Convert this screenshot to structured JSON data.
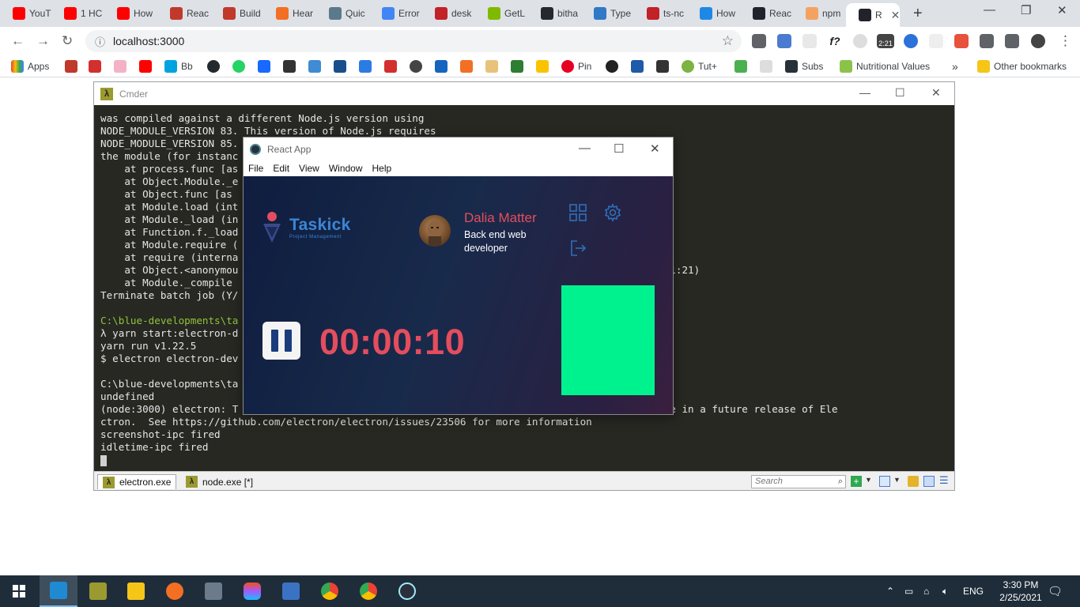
{
  "browser": {
    "tabs": [
      {
        "label": "YouT",
        "icon": "youtube-icon",
        "color": "#ff0000"
      },
      {
        "label": "1 HC",
        "icon": "youtube-icon",
        "color": "#ff0000"
      },
      {
        "label": "How",
        "icon": "youtube-icon",
        "color": "#ff0000"
      },
      {
        "label": "Reac",
        "icon": "react-icon",
        "color": "#c0392b"
      },
      {
        "label": "Build",
        "icon": "react-icon",
        "color": "#c0392b"
      },
      {
        "label": "Hear",
        "icon": "soundcloud-icon",
        "color": "#f26f23"
      },
      {
        "label": "Quic",
        "icon": "gear-icon",
        "color": "#5a7a8c"
      },
      {
        "label": "Error",
        "icon": "google-icon",
        "color": "#4285f4"
      },
      {
        "label": "desk",
        "icon": "npm-icon",
        "color": "#c12127"
      },
      {
        "label": "GetL",
        "icon": "microsoft-icon",
        "color": "#7fba00"
      },
      {
        "label": "bitha",
        "icon": "github-icon",
        "color": "#24292e"
      },
      {
        "label": "Type",
        "icon": "typescript-icon",
        "color": "#3178c6"
      },
      {
        "label": "ts-nc",
        "icon": "npm-icon",
        "color": "#c12127"
      },
      {
        "label": "How",
        "icon": "blue-circle-icon",
        "color": "#1e88e5"
      },
      {
        "label": "Reac",
        "icon": "react-icon",
        "color": "#20232a"
      },
      {
        "label": "npm",
        "icon": "npm-icon",
        "color": "#f4a261"
      },
      {
        "label": "R",
        "icon": "react-icon",
        "color": "#20232a"
      }
    ],
    "url": "localhost:3000",
    "bookmarks": {
      "apps_label": "Apps",
      "bb_label": "Bb",
      "pin_label": "Pin",
      "tut_label": "Tut+",
      "subs_label": "Subs",
      "nutrition_label": "Nutritional Values",
      "more_label": "»",
      "other_label": "Other bookmarks"
    },
    "ext_time": "2:21"
  },
  "cmder": {
    "title": "Cmder",
    "lines": [
      {
        "text": "was compiled against a different Node.js version using",
        "style": ""
      },
      {
        "text": "NODE_MODULE_VERSION 83. This version of Node.js requires",
        "style": ""
      },
      {
        "text": "NODE_MODULE_VERSION 85.",
        "style": ""
      },
      {
        "text": "the module (for instanc",
        "style": ""
      },
      {
        "text": "    at process.func [as",
        "style": ""
      },
      {
        "text": "    at Object.Module._e",
        "style": ""
      },
      {
        "text": "    at Object.func [as",
        "style": ""
      },
      {
        "text": "    at Module.load (int",
        "style": ""
      },
      {
        "text": "    at Module._load (in",
        "style": ""
      },
      {
        "text": "    at Function.f._load",
        "style": ""
      },
      {
        "text": "    at Module.require (",
        "style": ""
      },
      {
        "text": "    at require (interna",
        "style": ""
      },
      {
        "text": "    at Object.<anonymou                                                       op-idle\\index.js:1:21)",
        "style": ""
      },
      {
        "text": "    at Module._compile",
        "style": ""
      },
      {
        "text": "Terminate batch job (Y/",
        "style": ""
      },
      {
        "text": "",
        "style": ""
      },
      {
        "text": "C:\\blue-developments\\ta",
        "style": "g"
      },
      {
        "text": "λ yarn start:electron-d",
        "style": ""
      },
      {
        "text": "yarn run v1.22.5",
        "style": ""
      },
      {
        "text": "$ electron electron-dev",
        "style": ""
      },
      {
        "text": "",
        "style": ""
      },
      {
        "text": "C:\\blue-developments\\ta",
        "style": ""
      },
      {
        "text": "undefined",
        "style": ""
      },
      {
        "text": "(node:3000) electron: T                                                         om false to true in a future release of Ele",
        "style": ""
      },
      {
        "text": "ctron.  See https://github.com/electron/electron/issues/23506 for more information",
        "style": ""
      },
      {
        "text": "screenshot-ipc fired",
        "style": ""
      },
      {
        "text": "idletime-ipc fired",
        "style": ""
      }
    ],
    "tabs": [
      {
        "label": "electron.exe"
      },
      {
        "label": "node.exe [*]"
      }
    ],
    "search_placeholder": "Search"
  },
  "react_app": {
    "title": "React App",
    "menu": [
      "File",
      "Edit",
      "View",
      "Window",
      "Help"
    ],
    "logo_name": "Taskick",
    "logo_sub": "Project Management",
    "user_name": "Dalia Matter",
    "user_role": "Back end web developer",
    "timer": "00:00:10",
    "accent_color": "#e44d5e",
    "preview_color": "#00f28e"
  },
  "taskbar": {
    "language": "ENG",
    "time": "3:30 PM",
    "date": "2/25/2021"
  }
}
